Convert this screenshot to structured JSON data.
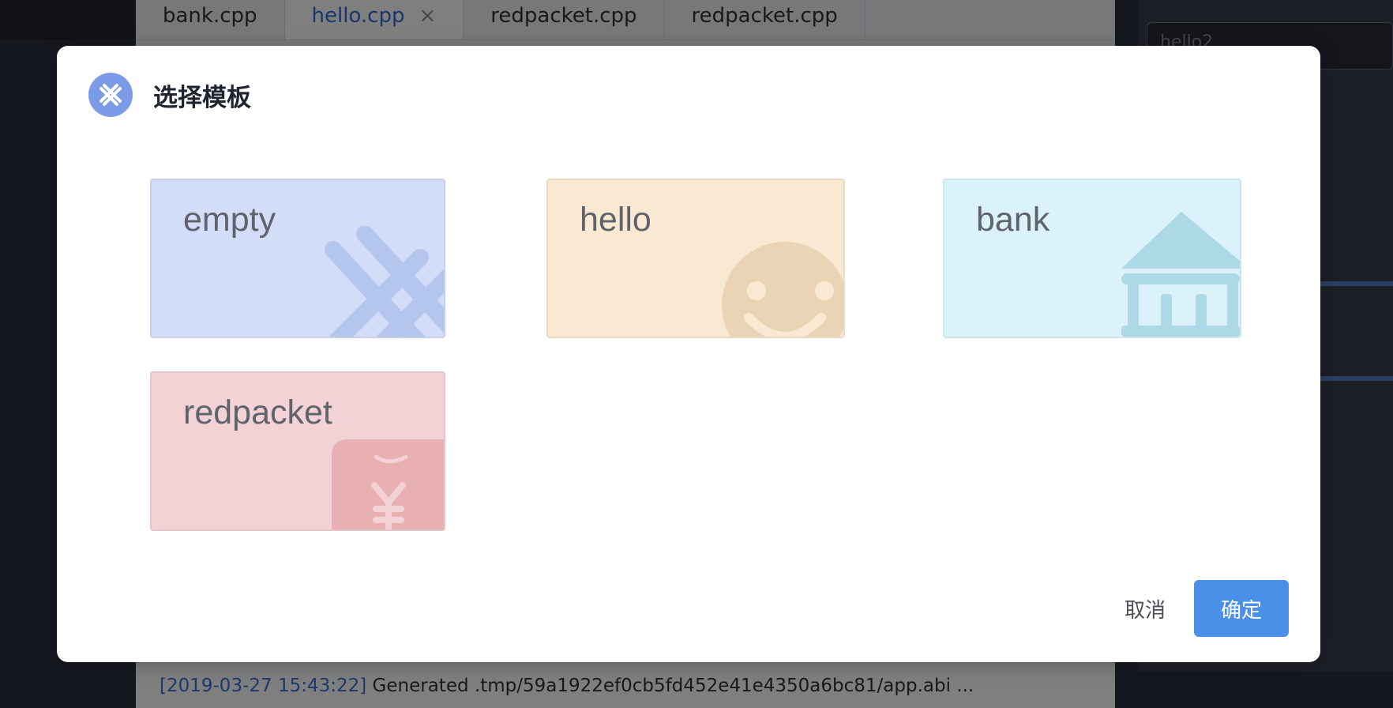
{
  "background": {
    "tabs": [
      {
        "label": "bank.cpp",
        "active": false
      },
      {
        "label": "hello.cpp",
        "active": true
      },
      {
        "label": "redpacket.cpp",
        "active": false
      },
      {
        "label": "redpacket.cpp",
        "active": false
      }
    ],
    "tab_close_glyph": "×",
    "console": {
      "timestamp": "[2019-03-27 15:43:22]",
      "message": "Generated .tmp/59a1922ef0cb5fd452e41e4350a6bc81/app.abi ..."
    },
    "right_panel_input_value": "hello2"
  },
  "dialog": {
    "title": "选择模板",
    "logo_icon": "eos-cross-icon",
    "templates": [
      {
        "id": "empty",
        "label": "empty",
        "icon": "cross-watermark-icon",
        "color": "#d4ddf8"
      },
      {
        "id": "hello",
        "label": "hello",
        "icon": "smiley-icon",
        "color": "#fae9d2"
      },
      {
        "id": "bank",
        "label": "bank",
        "icon": "bank-building-icon",
        "color": "#dbf2fb"
      },
      {
        "id": "redpacket",
        "label": "redpacket",
        "icon": "red-envelope-yen-icon",
        "color": "#f3d2d5"
      }
    ],
    "cancel_label": "取消",
    "confirm_label": "确定"
  },
  "colors": {
    "primary": "#4a8fe8",
    "logo": "#7b9ae8"
  }
}
